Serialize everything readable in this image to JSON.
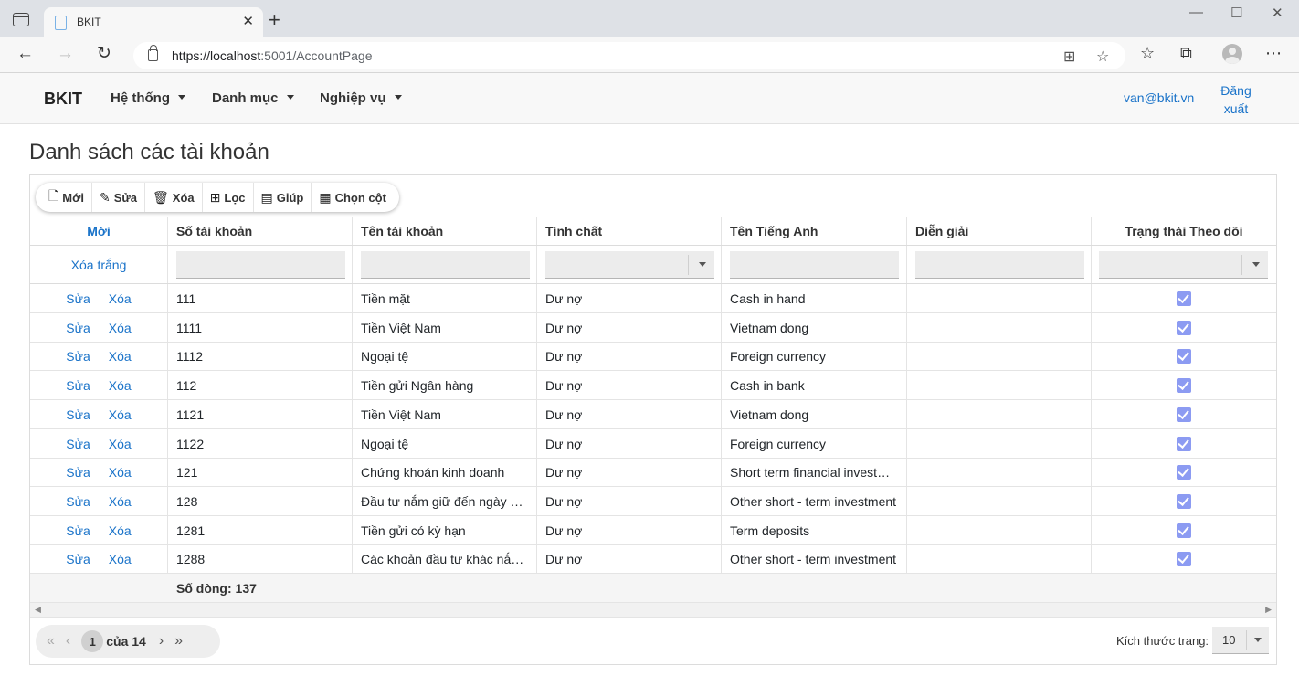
{
  "browser": {
    "tab_title": "BKIT",
    "url_host": "https://localhost",
    "url_path": ":5001/AccountPage"
  },
  "navbar": {
    "brand": "BKIT",
    "menus": [
      "Hệ thống",
      "Danh mục",
      "Nghiệp vụ"
    ],
    "user_email": "van@bkit.vn",
    "logout_line1": "Đăng",
    "logout_line2": "xuất"
  },
  "page": {
    "title": "Danh sách các tài khoản"
  },
  "toolbar": {
    "new": "Mới",
    "edit": "Sửa",
    "delete": "Xóa",
    "filter": "Lọc",
    "help": "Giúp",
    "choose_columns": "Chọn cột"
  },
  "grid": {
    "header_new": "Mới",
    "clear_filter": "Xóa trắng",
    "columns": [
      "Số tài khoản",
      "Tên tài khoản",
      "Tính chất",
      "Tên Tiếng Anh",
      "Diễn giải",
      "Trạng thái Theo dõi"
    ],
    "edit_label": "Sửa",
    "delete_label": "Xóa",
    "rows": [
      {
        "code": "111",
        "name": "Tiền mặt",
        "nature": "Dư nợ",
        "english": "Cash in hand",
        "desc": "",
        "tracked": true
      },
      {
        "code": "1111",
        "name": "Tiền Việt Nam",
        "nature": "Dư nợ",
        "english": "Vietnam dong",
        "desc": "",
        "tracked": true
      },
      {
        "code": "1112",
        "name": "Ngoại tệ",
        "nature": "Dư nợ",
        "english": "Foreign currency",
        "desc": "",
        "tracked": true
      },
      {
        "code": "112",
        "name": "Tiền gửi Ngân hàng",
        "nature": "Dư nợ",
        "english": "Cash in bank",
        "desc": "",
        "tracked": true
      },
      {
        "code": "1121",
        "name": "Tiền Việt Nam",
        "nature": "Dư nợ",
        "english": "Vietnam dong",
        "desc": "",
        "tracked": true
      },
      {
        "code": "1122",
        "name": "Ngoại tệ",
        "nature": "Dư nợ",
        "english": "Foreign currency",
        "desc": "",
        "tracked": true
      },
      {
        "code": "121",
        "name": "Chứng khoán kinh doanh",
        "nature": "Dư nợ",
        "english": "Short term financial invest…",
        "desc": "",
        "tracked": true
      },
      {
        "code": "128",
        "name": "Đầu tư nắm giữ đến ngày …",
        "nature": "Dư nợ",
        "english": "Other short - term investment",
        "desc": "",
        "tracked": true
      },
      {
        "code": "1281",
        "name": "Tiền gửi có kỳ hạn",
        "nature": "Dư nợ",
        "english": "Term deposits",
        "desc": "",
        "tracked": true
      },
      {
        "code": "1288",
        "name": "Các khoản đầu tư khác nắ…",
        "nature": "Dư nợ",
        "english": "Other short - term investment",
        "desc": "",
        "tracked": true
      }
    ],
    "summary": "Số dòng: 137"
  },
  "pager": {
    "current_page": "1",
    "of_total": "của 14",
    "page_size_label": "Kích thước trang:",
    "page_size": "10"
  }
}
